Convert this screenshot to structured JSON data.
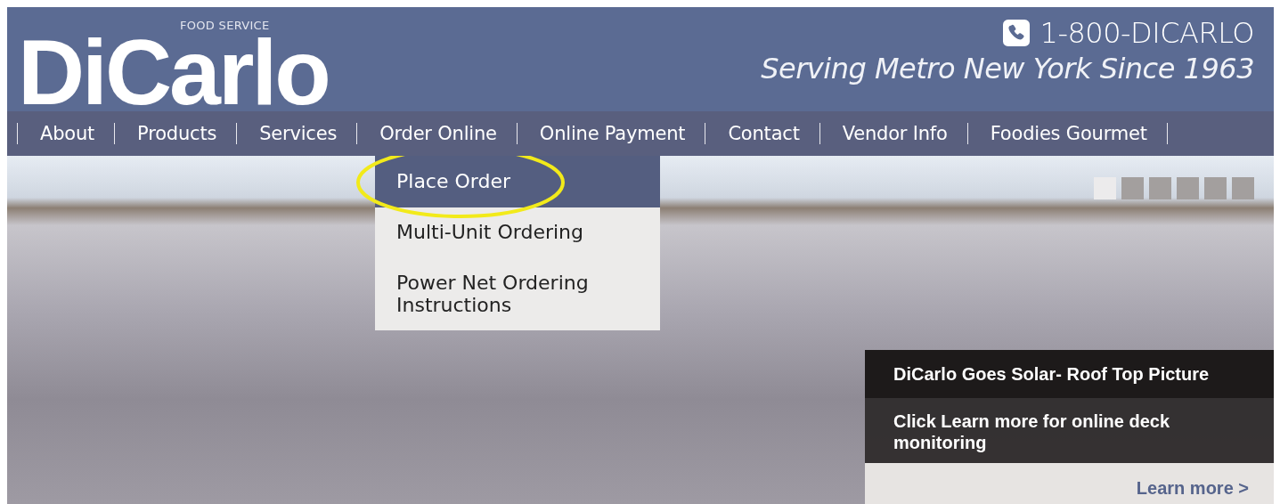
{
  "logo": {
    "name": "DiCarlo",
    "tagline": "FOOD SERVICE"
  },
  "phone": "1-800-DICARLO",
  "slogan": "Serving Metro New York Since 1963",
  "nav": [
    {
      "label": "About"
    },
    {
      "label": "Products"
    },
    {
      "label": "Services"
    },
    {
      "label": "Order Online"
    },
    {
      "label": "Online Payment"
    },
    {
      "label": "Contact"
    },
    {
      "label": "Vendor Info"
    },
    {
      "label": "Foodies Gourmet"
    }
  ],
  "dropdown": [
    {
      "label": "Place Order",
      "selected": true
    },
    {
      "label": "Multi-Unit Ordering",
      "selected": false
    },
    {
      "label": "Power Net Ordering Instructions",
      "selected": false
    }
  ],
  "slides": [
    {
      "selected": true
    },
    {
      "selected": false
    },
    {
      "selected": false
    },
    {
      "selected": false
    },
    {
      "selected": false
    },
    {
      "selected": false
    }
  ],
  "caption": {
    "title": "DiCarlo Goes Solar- Roof Top Picture",
    "text": "Click Learn more for online deck monitoring",
    "link": "Learn more >"
  }
}
